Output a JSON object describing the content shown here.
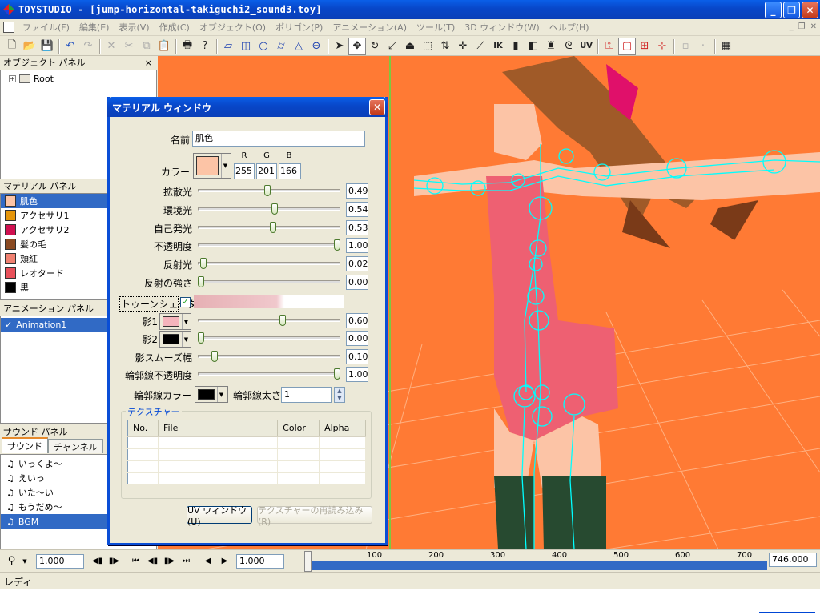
{
  "window": {
    "title": "TOYSTUDIO - [jump-horizontal-takiguchi2_sound3.toy]",
    "minimize": "_",
    "maximize": "❐",
    "close": "✕"
  },
  "menu": [
    "ファイル(F)",
    "編集(E)",
    "表示(V)",
    "作成(C)",
    "オブジェクト(O)",
    "ポリゴン(P)",
    "アニメーション(A)",
    "ツール(T)",
    "3D ウィンドウ(W)",
    "ヘルプ(H)"
  ],
  "toolbar": {
    "icons": [
      "new-icon",
      "open-icon",
      "save-icon",
      "undo-icon",
      "redo-icon",
      "delete-icon",
      "cut-icon",
      "copy-icon",
      "paste-icon",
      "print-icon",
      "help-icon",
      "rect-icon",
      "cube-icon",
      "circle-icon",
      "cylinder-icon",
      "cone-icon",
      "torus-icon",
      "select-arrow-icon",
      "move-icon",
      "rotate-icon",
      "scale-icon",
      "extrude-icon",
      "edit-icon",
      "flip-icon",
      "axis-icon",
      "bone-icon",
      "ik-icon",
      "bar-a-icon",
      "bar-b-icon",
      "stamp-icon",
      "twist-icon",
      "uv-icon",
      "bone-select-icon",
      "box-select-icon",
      "mesh-icon",
      "axes-icon",
      "blank-a-icon",
      "blank-b-icon",
      "grid-icon"
    ],
    "ik_label": "IK",
    "uv_label": "UV"
  },
  "object_panel": {
    "header": "オブジェクト パネル",
    "close": "×",
    "root_label": "Root",
    "expand": "+"
  },
  "material_panel": {
    "header": "マテリアル パネル",
    "items": [
      {
        "name": "肌色",
        "color": "#fcc4a6",
        "selected": true
      },
      {
        "name": "アクセサリ1",
        "color": "#e6960a",
        "selected": false
      },
      {
        "name": "アクセサリ2",
        "color": "#d01050",
        "selected": false
      },
      {
        "name": "髪の毛",
        "color": "#8a4a22",
        "selected": false
      },
      {
        "name": "頬紅",
        "color": "#f08070",
        "selected": false
      },
      {
        "name": "レオタード",
        "color": "#e8505a",
        "selected": false
      },
      {
        "name": "黒",
        "color": "#000000",
        "selected": false
      }
    ]
  },
  "animation_panel": {
    "header": "アニメーション パネル",
    "item": "Animation1",
    "check": "✓"
  },
  "sound_panel": {
    "header": "サウンド パネル",
    "tabs": [
      "サウンド",
      "チャンネル"
    ],
    "items": [
      "いっくよ～",
      "えいっ",
      "いた～い",
      "もうだめ～",
      "BGM"
    ],
    "selected_index": 4,
    "note": "♫"
  },
  "material_window": {
    "title": "マテリアル ウィンドウ",
    "close": "✕",
    "name_label": "名前",
    "name_value": "肌色",
    "color_label": "カラー",
    "color_hex": "#fcc4a6",
    "rgb_headers": [
      "R",
      "G",
      "B"
    ],
    "rgb_values": [
      "255",
      "201",
      "166"
    ],
    "sliders": [
      {
        "label": "拡散光",
        "value": "0.49",
        "frac": 0.49
      },
      {
        "label": "環境光",
        "value": "0.54",
        "frac": 0.54
      },
      {
        "label": "自己発光",
        "value": "0.53",
        "frac": 0.53
      },
      {
        "label": "不透明度",
        "value": "1.00",
        "frac": 1.0
      },
      {
        "label": "反射光",
        "value": "0.02",
        "frac": 0.02
      },
      {
        "label": "反射の強さ",
        "value": "0.00",
        "frac": 0.0
      }
    ],
    "toon_label": "トゥーンシェーダ",
    "toon_checked": true,
    "shadow1_label": "影1",
    "shadow1_color": "#f4b4bc",
    "shadow1_value": "0.60",
    "shadow1_frac": 0.6,
    "shadow2_label": "影2",
    "shadow2_color": "#000000",
    "shadow2_value": "0.00",
    "shadow2_frac": 0.0,
    "smooth_label": "影スムーズ幅",
    "smooth_value": "0.10",
    "smooth_frac": 0.1,
    "outline_opacity_label": "輪郭線不透明度",
    "outline_opacity_value": "1.00",
    "outline_opacity_frac": 1.0,
    "outline_color_label": "輪郭線カラー",
    "outline_color": "#000000",
    "outline_width_label": "輪郭線太さ",
    "outline_width_value": "1",
    "texture_group": "テクスチャー",
    "texture_columns": [
      "No.",
      "File",
      "Color",
      "Alpha"
    ],
    "uv_button": "UV ウィンドウ(U)",
    "reload_button": "テクスチャーの再読み込み(R)"
  },
  "timeline": {
    "start_value": "1.000",
    "current_value": "1.000",
    "end_value": "746.000",
    "ticks": [
      "100",
      "200",
      "300",
      "400",
      "500",
      "600",
      "700"
    ]
  },
  "status": {
    "text": "レディ"
  }
}
